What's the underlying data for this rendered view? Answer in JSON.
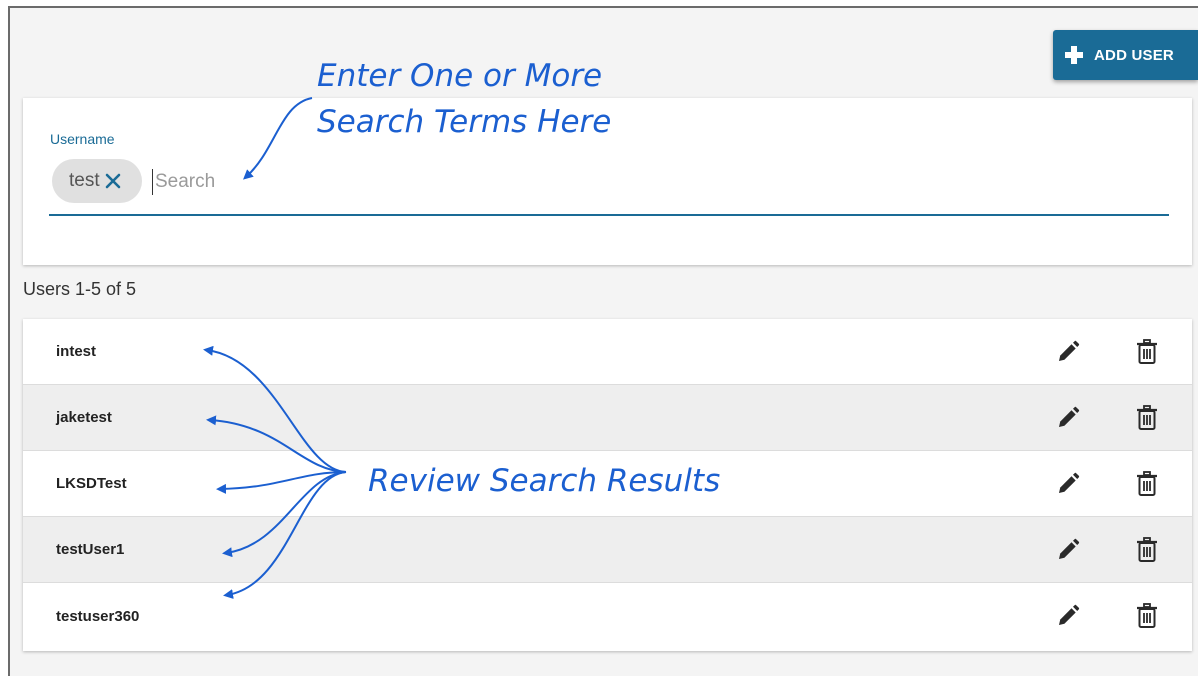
{
  "toolbar": {
    "add_user_label": "ADD USER"
  },
  "search": {
    "field_label": "Username",
    "chips": [
      {
        "value": "test"
      }
    ],
    "placeholder": "Search",
    "value": ""
  },
  "results": {
    "count_text": "Users 1-5 of 5",
    "users": [
      {
        "username": "intest"
      },
      {
        "username": "jaketest"
      },
      {
        "username": "LKSDTest"
      },
      {
        "username": "testUser1"
      },
      {
        "username": "testuser360"
      }
    ]
  },
  "annotations": {
    "search_hint_line1": "Enter One or More",
    "search_hint_line2": "Search Terms Here",
    "results_hint": "Review Search Results"
  },
  "icons": {
    "add": "plus-icon",
    "chip_remove": "close-icon",
    "edit": "pencil-icon",
    "delete": "trash-icon"
  },
  "colors": {
    "accent": "#1a6b96",
    "annotation": "#1b5fd0",
    "row_alt": "#eeeeee",
    "background": "#f4f4f4"
  }
}
